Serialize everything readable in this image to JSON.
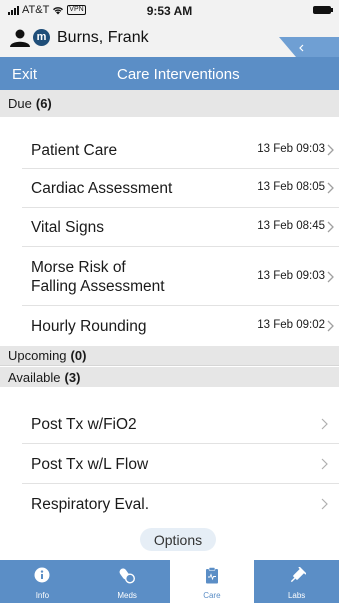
{
  "status_bar": {
    "carrier": "AT&T",
    "vpn": "VPN",
    "time": "9:53 AM"
  },
  "patient": {
    "badge": "m",
    "name": "Burns, Frank"
  },
  "nav": {
    "exit": "Exit",
    "title": "Care Interventions"
  },
  "sections": {
    "due": {
      "label": "Due",
      "count": "(6)"
    },
    "upcoming": {
      "label": "Upcoming",
      "count": "(0)"
    },
    "available": {
      "label": "Available",
      "count": "(3)"
    }
  },
  "due_items": [
    {
      "label": "Patient Care",
      "time": "13 Feb 09:03"
    },
    {
      "label": "Cardiac Assessment",
      "time": "13 Feb 08:05"
    },
    {
      "label": "Vital Signs",
      "time": "13 Feb 08:45"
    },
    {
      "label_line1": "Morse Risk of",
      "label_line2": "Falling Assessment",
      "time": "13 Feb 09:03"
    },
    {
      "label": "Hourly Rounding",
      "time": "13 Feb 09:02"
    }
  ],
  "available_items": [
    {
      "label": "Post Tx w/FiO2"
    },
    {
      "label": "Post Tx w/L Flow"
    },
    {
      "label": "Respiratory Eval."
    }
  ],
  "options_label": "Options",
  "tabs": [
    {
      "label": "Info",
      "icon": "info-icon"
    },
    {
      "label": "Meds",
      "icon": "pills-icon"
    },
    {
      "label": "Care",
      "icon": "clipboard-icon",
      "active": true
    },
    {
      "label": "Labs",
      "icon": "syringe-icon"
    }
  ],
  "colors": {
    "brand": "#5b8ec6",
    "section_bg": "#e6e6e6",
    "badge": "#1f4e79"
  }
}
